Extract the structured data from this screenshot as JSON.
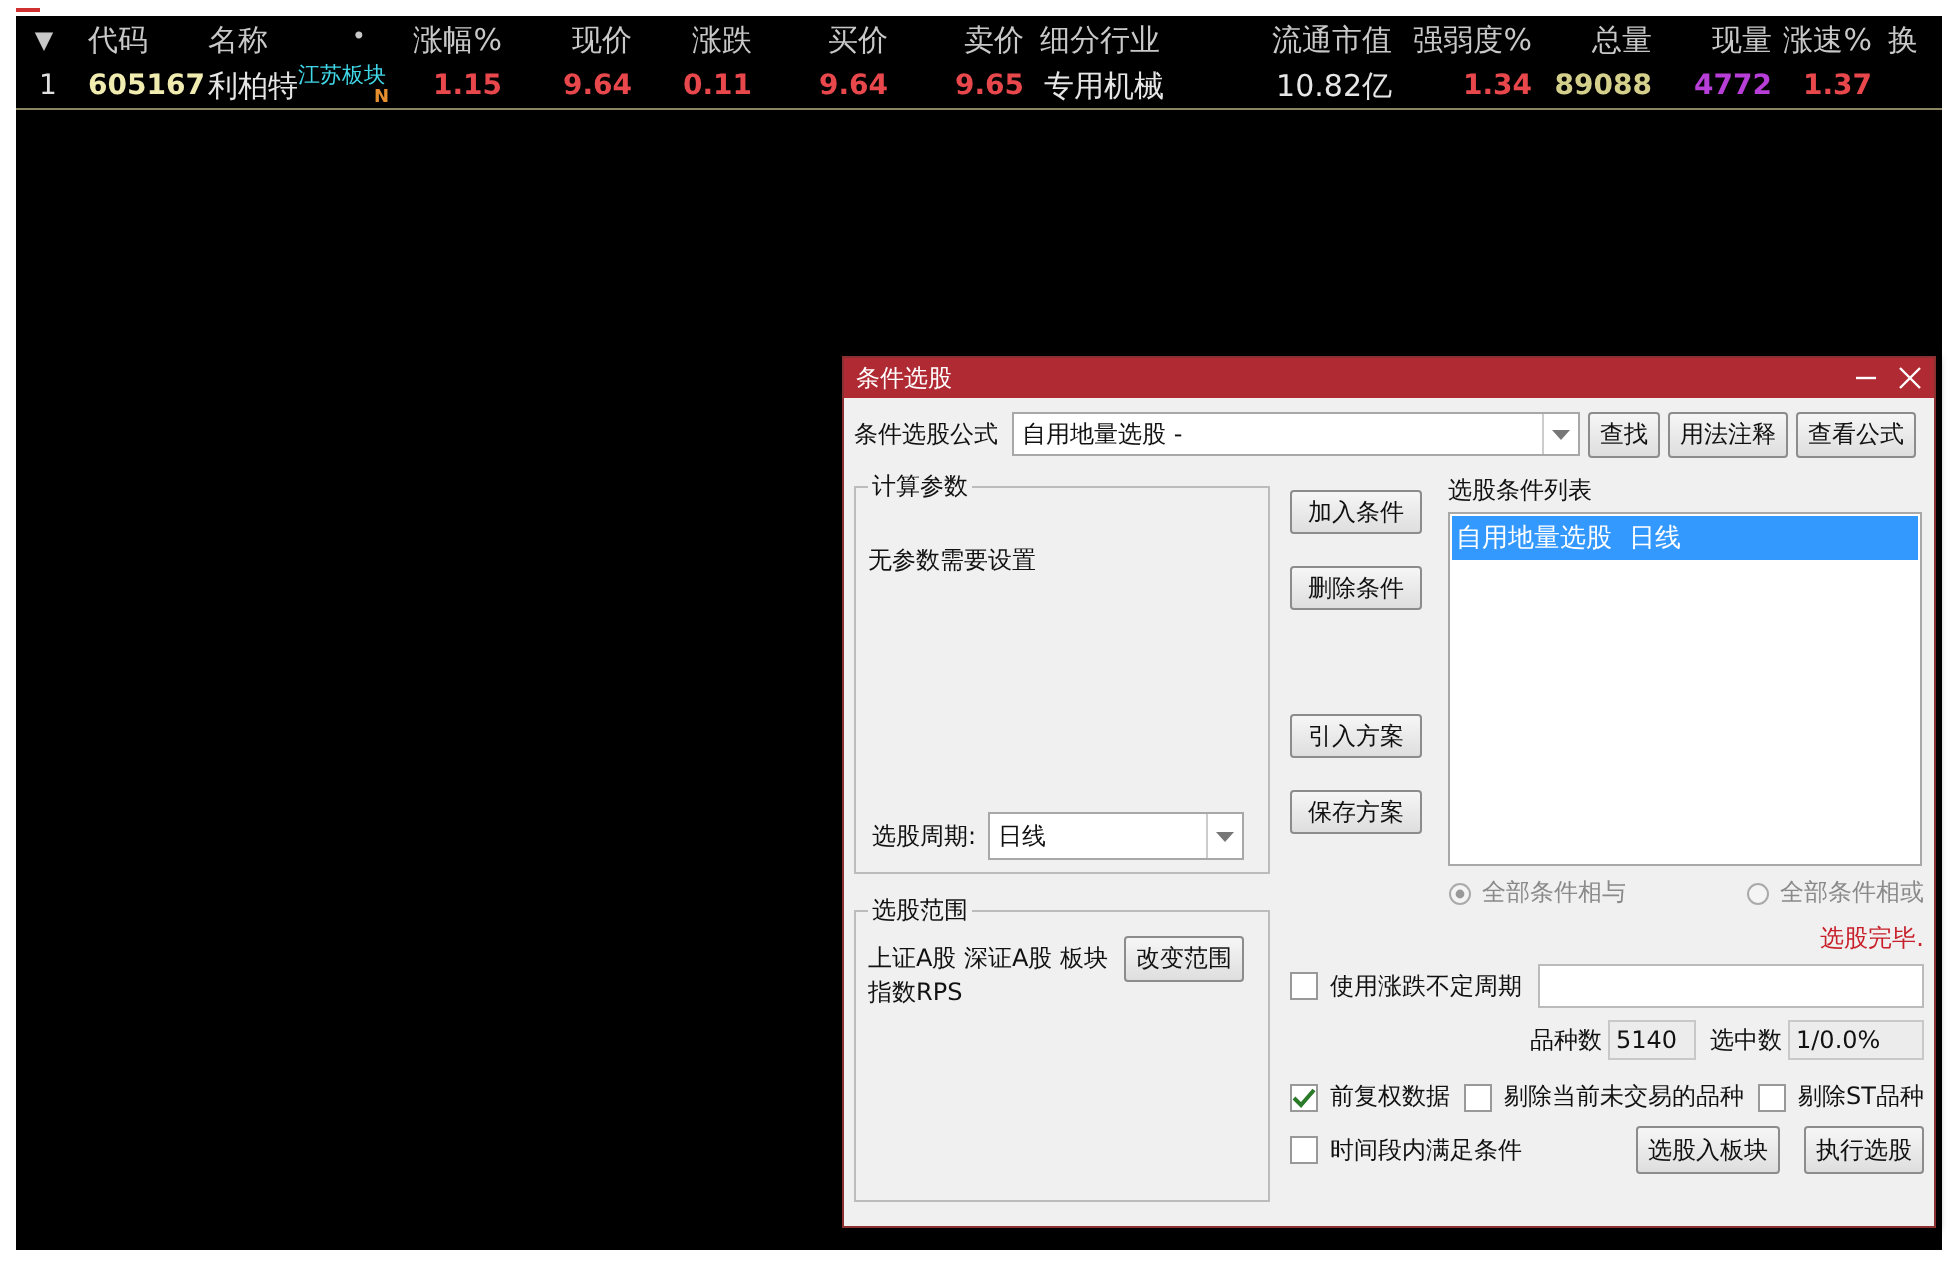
{
  "table": {
    "name_marker": "•",
    "columns": [
      "▼",
      "代码",
      "名称",
      "涨幅%",
      "现价",
      "涨跌",
      "买价",
      "卖价",
      "细分行业",
      "流通市值",
      "强弱度%",
      "总量",
      "现量",
      "涨速%",
      "换"
    ],
    "rows": [
      {
        "cells": [
          {
            "text": "1",
            "color": "#e0e0e0",
            "kind": "cell"
          },
          {
            "text": "605167",
            "color": "#f0ecb0",
            "kind": "cell"
          },
          {
            "text": "利柏特",
            "color": "#e6e6e6",
            "kind": "name",
            "tag": "江苏板块",
            "flag": "N"
          },
          {
            "text": "1.15",
            "color": "#e8484c",
            "kind": "cell"
          },
          {
            "text": "9.64",
            "color": "#e8484c"
          },
          {
            "text": "0.11",
            "color": "#e8484c"
          },
          {
            "text": "9.64",
            "color": "#e8484c"
          },
          {
            "text": "9.65",
            "color": "#e8484c"
          },
          {
            "text": "专用机械",
            "color": "#e6e6e6"
          },
          {
            "text": "10.82亿",
            "color": "#e6e6e6"
          },
          {
            "text": "1.34",
            "color": "#e8484c"
          },
          {
            "text": "89088",
            "color": "#d4d08c"
          },
          {
            "text": "4772",
            "color": "#b83ed8"
          },
          {
            "text": "1.37",
            "color": "#e8484c"
          }
        ]
      }
    ]
  },
  "dialog": {
    "title": "条件选股",
    "formula": {
      "label": "条件选股公式",
      "value": "自用地量选股 -"
    },
    "top_buttons": [
      "查找",
      "用法注释",
      "查看公式"
    ],
    "params": {
      "title": "计算参数",
      "text": "无参数需要设置",
      "period_label": "选股周期:",
      "period_value": "日线"
    },
    "action_buttons": [
      "加入条件",
      "删除条件",
      "引入方案",
      "保存方案"
    ],
    "conditions": {
      "label": "选股条件列表",
      "items": [
        {
          "text": "自用地量选股  日线",
          "selected": true
        }
      ]
    },
    "combine": [
      {
        "label": "全部条件相与",
        "selected": true,
        "disabled": true
      },
      {
        "label": "全部条件相或",
        "selected": false,
        "disabled": true
      }
    ],
    "status": "选股完毕.",
    "scope": {
      "title": "选股范围",
      "text": "上证A股 深证A股 板块指数RPS",
      "button": "改变范围"
    },
    "variable_period": {
      "label": "使用涨跌不定周期",
      "checked": false
    },
    "counts": [
      {
        "label": "品种数",
        "value": "5140"
      },
      {
        "label": "选中数",
        "value": "1/0.0%"
      }
    ],
    "options": [
      {
        "label": "前复权数据",
        "checked": true
      },
      {
        "label": "剔除当前未交易的品种",
        "checked": false
      },
      {
        "label": "剔除ST品种",
        "checked": false
      }
    ],
    "time_check": {
      "label": "时间段内满足条件",
      "checked": false
    },
    "bottom_buttons": [
      "选股入板块",
      "执行选股"
    ]
  }
}
